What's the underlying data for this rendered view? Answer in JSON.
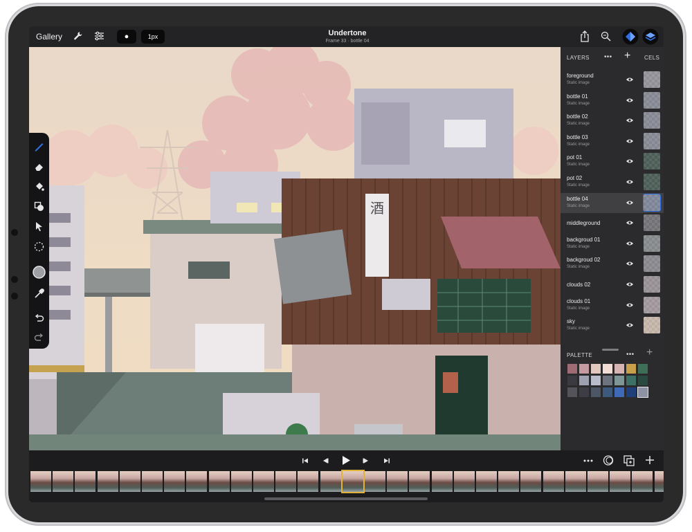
{
  "app": {
    "gallery_label": "Gallery",
    "brush_shape_label": "●",
    "brush_size_label": "1px",
    "title": "Undertone",
    "subtitle": "Frame 33 · bottle 04"
  },
  "layers_panel": {
    "header": "LAYERS",
    "more_label": "•••",
    "add_label": "+",
    "cels_header": "CELS",
    "items": [
      {
        "name": "foreground",
        "sub": "Static image",
        "cel": "#9d9da3"
      },
      {
        "name": "bottle 01",
        "sub": "Static image",
        "cel": "#8a8f99"
      },
      {
        "name": "bottle 02",
        "sub": "Static image",
        "cel": "#8a8f99"
      },
      {
        "name": "bottle 03",
        "sub": "Static image",
        "cel": "#8a8f99"
      },
      {
        "name": "pot 01",
        "sub": "Static image",
        "cel": "#2f4a3a"
      },
      {
        "name": "pot 02",
        "sub": "Static image",
        "cel": "#2f4a3a"
      },
      {
        "name": "bottle 04",
        "sub": "Static image",
        "cel": "#7e8aa4"
      },
      {
        "name": "middleground",
        "sub": "",
        "cel": "#6d6c70"
      },
      {
        "name": "backgroud 01",
        "sub": "Static image",
        "cel": "#8b8f8f"
      },
      {
        "name": "backgroud 02",
        "sub": "Static image",
        "cel": "#8d8d92"
      },
      {
        "name": "clouds 02",
        "sub": "",
        "cel": "#a59a9c"
      },
      {
        "name": "clouds 01",
        "sub": "Static image",
        "cel": "#b3a5a6"
      },
      {
        "name": "sky",
        "sub": "Static image",
        "cel": "#ecd3bd"
      }
    ],
    "active_index": 6
  },
  "palette_panel": {
    "header": "PALETTE",
    "more_label": "•••",
    "add_label": "+",
    "colors": [
      "#9f6b74",
      "#c59aa0",
      "#e2c8bf",
      "#f1ddd3",
      "#d6b4b2",
      "#c8a04c",
      "#3f6e58",
      "#3a3a40",
      "#9ea2b0",
      "#b9bccb",
      "#6e7380",
      "#7f9696",
      "#3f7066",
      "#2a4a40",
      "#55535a",
      "#3d3d45",
      "#4c5665",
      "#3d5a7c",
      "#3e6ab8",
      "#1f3f7a",
      "#8d93a3"
    ]
  },
  "timeline": {
    "frame_count": 29,
    "active_frame": 14
  },
  "colors": {
    "accent": "#2f6fe0",
    "active_frame_border": "#e0b43a"
  }
}
